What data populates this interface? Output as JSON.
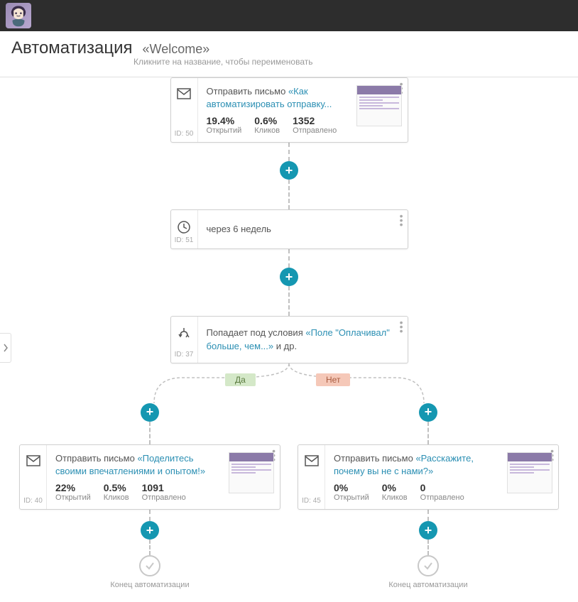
{
  "header": {
    "title": "Автоматизация",
    "subtitle": "«Welcome»",
    "hint": "Кликните на название, чтобы переименовать"
  },
  "branch_labels": {
    "yes": "Да",
    "no": "Нет"
  },
  "end_label": "Конец автоматизации",
  "nodes": {
    "n50": {
      "id": "ID: 50",
      "prefix": "Отправить письмо ",
      "link": "«Как автоматизировать отправку...",
      "stats": [
        {
          "v": "19.4%",
          "l": "Открытий"
        },
        {
          "v": "0.6%",
          "l": "Кликов"
        },
        {
          "v": "1352",
          "l": "Отправлено"
        }
      ]
    },
    "n51": {
      "id": "ID: 51",
      "text": "через 6 недель"
    },
    "n37": {
      "id": "ID: 37",
      "prefix": "Попадает под условия ",
      "link": "«Поле \"Оплачивал\" больше, чем...»",
      "suffix": " и др."
    },
    "n40": {
      "id": "ID: 40",
      "prefix": "Отправить письмо ",
      "link": "«Поделитесь своими впечатлениями и опытом!»",
      "stats": [
        {
          "v": "22%",
          "l": "Открытий"
        },
        {
          "v": "0.5%",
          "l": "Кликов"
        },
        {
          "v": "1091",
          "l": "Отправлено"
        }
      ]
    },
    "n45": {
      "id": "ID: 45",
      "prefix": "Отправить письмо ",
      "link": "«Расскажите, почему вы не с нами?»",
      "stats": [
        {
          "v": "0%",
          "l": "Открытий"
        },
        {
          "v": "0%",
          "l": "Кликов"
        },
        {
          "v": "0",
          "l": "Отправлено"
        }
      ]
    }
  }
}
